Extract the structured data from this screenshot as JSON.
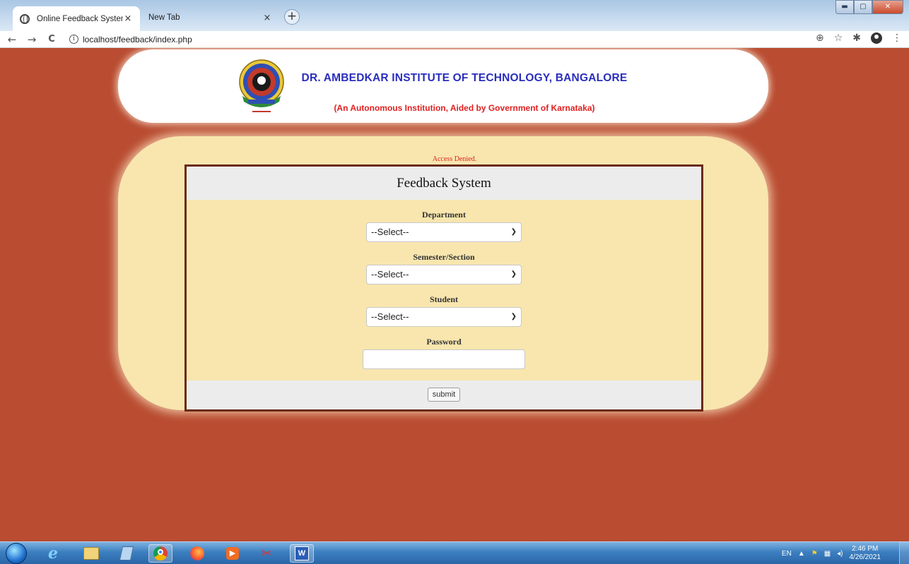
{
  "browser": {
    "tabs": [
      {
        "title": "Online Feedback System",
        "active": true
      },
      {
        "title": "New Tab",
        "active": false
      }
    ],
    "new_tab_symbol": "+",
    "close_symbol": "×",
    "address": "localhost/feedback/index.php",
    "nav": {
      "back": "←",
      "forward": "→",
      "reload": "C"
    },
    "toolbar_icons": [
      "zoom-icon",
      "star-icon",
      "extensions-icon",
      "profile-icon",
      "menu-icon"
    ]
  },
  "header": {
    "institute_name": "DR. AMBEDKAR INSTITUTE OF TECHNOLOGY, BANGALORE",
    "institute_subtitle": "(An Autonomous Institution, Aided by Government of Karnataka)"
  },
  "page": {
    "access_message": "Access Denied."
  },
  "form": {
    "title": "Feedback System",
    "department_label": "Department",
    "department_value": "--Select--",
    "semester_label": "Semester/Section",
    "semester_value": "--Select--",
    "student_label": "Student",
    "student_value": "--Select--",
    "password_label": "Password",
    "submit_label": "submit"
  },
  "taskbar": {
    "language": "EN",
    "time": "2:46 PM",
    "date": "4/26/2021"
  },
  "colors": {
    "page_background": "#b94c31",
    "panel": "#f8e6ae",
    "institute_name": "#2a2ebd",
    "alert_text": "#e02020"
  }
}
